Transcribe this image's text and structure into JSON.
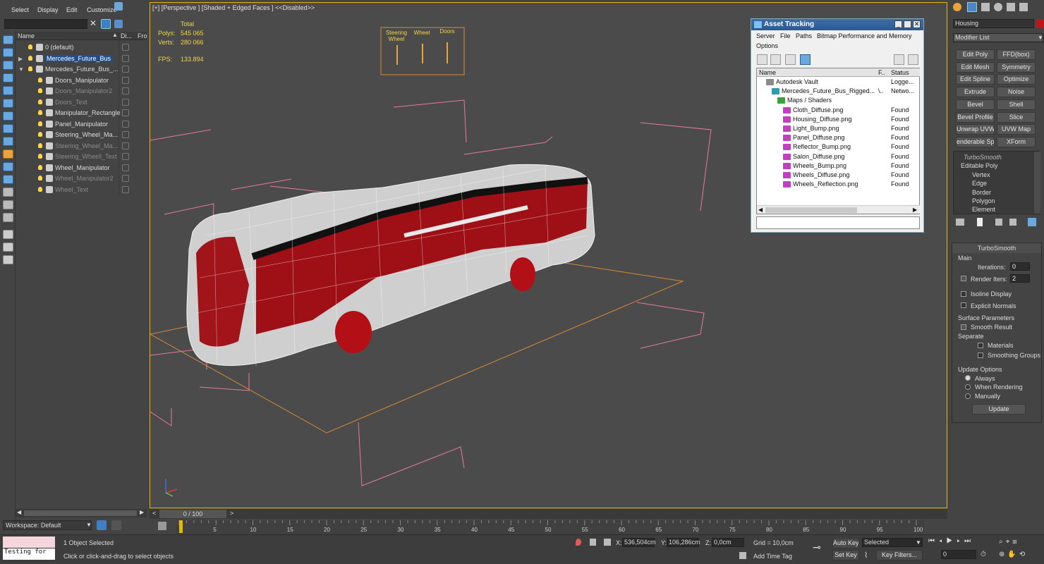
{
  "menu": {
    "items": [
      "Select",
      "Display",
      "Edit",
      "Customize"
    ]
  },
  "explorer": {
    "col_name": "Name",
    "col_d": "Di...",
    "col_fr": "Fro",
    "rows": [
      {
        "label": "0 (default)",
        "dim": false,
        "selected": false
      },
      {
        "label": "Mercedes_Future_Bus",
        "dim": false,
        "selected": true
      },
      {
        "label": "Mercedes_Future_Bus_...",
        "dim": false,
        "selected": false
      },
      {
        "label": "Doors_Manipulator",
        "dim": false,
        "selected": false
      },
      {
        "label": "Doors_Manipulator2",
        "dim": true,
        "selected": false
      },
      {
        "label": "Doors_Text",
        "dim": true,
        "selected": false
      },
      {
        "label": "Manipulator_Rectangle",
        "dim": false,
        "selected": false
      },
      {
        "label": "Panel_Manipulator",
        "dim": false,
        "selected": false
      },
      {
        "label": "Steering_Wheel_Ma...",
        "dim": false,
        "selected": false
      },
      {
        "label": "Steering_Wheel_Ma...",
        "dim": true,
        "selected": false
      },
      {
        "label": "Steering_Wheell_Text",
        "dim": true,
        "selected": false
      },
      {
        "label": "Wheel_Manipulator",
        "dim": false,
        "selected": false
      },
      {
        "label": "Wheel_Manipulator2",
        "dim": true,
        "selected": false
      },
      {
        "label": "Wheel_Text",
        "dim": true,
        "selected": false
      }
    ],
    "workspace": "Workspace: Default"
  },
  "viewport": {
    "label": "[+] [Perspective ] [Shaded + Edged Faces ]  <<Disabled>>",
    "stats": {
      "total": "Total",
      "polys_label": "Polys:",
      "polys": "545 065",
      "verts_label": "Verts:",
      "verts": "280 066",
      "fps_label": "FPS:",
      "fps": "133.894"
    },
    "panel_labels": [
      "Steering\nWheel",
      "Wheel",
      "Doors"
    ]
  },
  "asset_tracking": {
    "title": "Asset Tracking",
    "menu": [
      "Server",
      "File",
      "Paths",
      "Bitmap Performance and Memory",
      "Options"
    ],
    "col_name": "Name",
    "col_f": "F..",
    "col_status": "Status",
    "rows": [
      {
        "name": "Autodesk Vault",
        "status": "Logge...",
        "indent": 1,
        "type": "vault"
      },
      {
        "name": "Mercedes_Future_Bus_Rigged...",
        "status": "Netwo...",
        "f": "\\..",
        "indent": 2,
        "type": "max"
      },
      {
        "name": "Maps / Shaders",
        "status": "",
        "indent": 3,
        "type": "maps"
      },
      {
        "name": "Cloth_Diffuse.png",
        "status": "Found",
        "indent": 4,
        "type": "png"
      },
      {
        "name": "Housing_Diffuse.png",
        "status": "Found",
        "indent": 4,
        "type": "png"
      },
      {
        "name": "Light_Bump.png",
        "status": "Found",
        "indent": 4,
        "type": "png"
      },
      {
        "name": "Panel_Diffuse.png",
        "status": "Found",
        "indent": 4,
        "type": "png"
      },
      {
        "name": "Reflector_Bump.png",
        "status": "Found",
        "indent": 4,
        "type": "png"
      },
      {
        "name": "Salon_Diffuse.png",
        "status": "Found",
        "indent": 4,
        "type": "png"
      },
      {
        "name": "Wheels_Bump.png",
        "status": "Found",
        "indent": 4,
        "type": "png"
      },
      {
        "name": "Wheels_Diffuse.png",
        "status": "Found",
        "indent": 4,
        "type": "png"
      },
      {
        "name": "Wheels_Reflection.png",
        "status": "Found",
        "indent": 4,
        "type": "png"
      }
    ]
  },
  "command_panel": {
    "object_name": "Housing",
    "modifier_list": "Modifier List",
    "modifier_buttons": [
      "Edit Poly",
      "FFD(box)",
      "Edit Mesh",
      "Symmetry",
      "Edit Spline",
      "Optimize",
      "Extrude",
      "Noise",
      "Bevel",
      "Shell",
      "Bevel Profile",
      "Slice",
      "Unwrap UVW",
      "UVW Map",
      "enderable Splin",
      "XForm"
    ],
    "stack": [
      "TurboSmooth",
      "Editable Poly",
      "Vertex",
      "Edge",
      "Border",
      "Polygon",
      "Element"
    ],
    "rollout_title": "TurboSmooth",
    "main_label": "Main",
    "iterations_label": "Iterations:",
    "iterations": "0",
    "render_iters_label": "Render Iters:",
    "render_iters": "2",
    "isoline": "Isoline Display",
    "explicit_normals": "Explicit Normals",
    "surface_params": "Surface Parameters",
    "smooth_result": "Smooth Result",
    "separate": "Separate",
    "materials": "Materials",
    "smoothing_groups": "Smoothing Groups",
    "update_options": "Update Options",
    "always": "Always",
    "when_rendering": "When Rendering",
    "manually": "Manually",
    "update_btn": "Update"
  },
  "timeline": {
    "frame": "0 / 100",
    "ticks": [
      "5",
      "10",
      "15",
      "20",
      "25",
      "30",
      "35",
      "40",
      "45",
      "50",
      "55",
      "60",
      "65",
      "70",
      "75",
      "80",
      "85",
      "90",
      "95",
      "100"
    ]
  },
  "status": {
    "script": "Testing for",
    "selected": "1 Object Selected",
    "prompt": "Click or click-and-drag to select objects",
    "x_label": "X:",
    "x": "536,504cm",
    "y_label": "Y:",
    "y": "106,286cm",
    "z_label": "Z:",
    "z": "0,0cm",
    "grid": "Grid = 10,0cm",
    "add_time_tag": "Add Time Tag",
    "auto_key": "Auto Key",
    "set_key": "Set Key",
    "selected_dropdown": "Selected",
    "key_filters": "Key Filters...",
    "frame_field": "0"
  }
}
